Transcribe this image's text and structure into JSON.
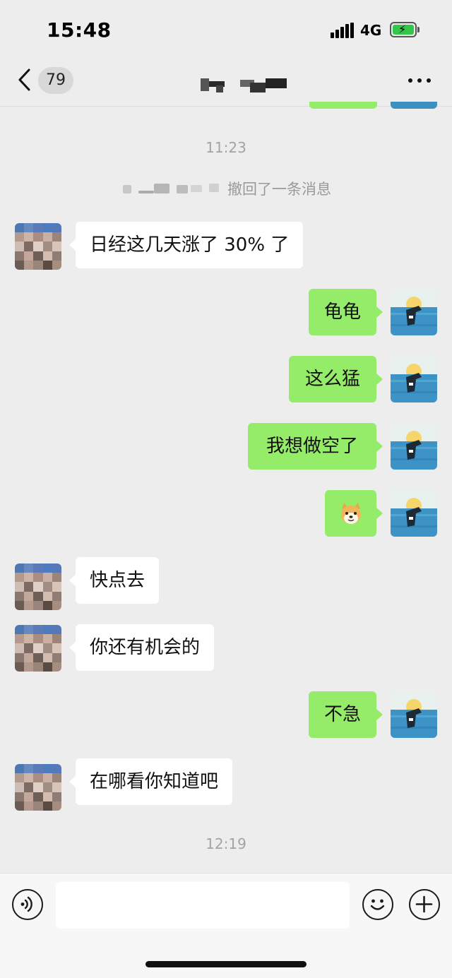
{
  "status": {
    "time": "15:48",
    "network": "4G"
  },
  "nav": {
    "unread_count": "79"
  },
  "timestamps": [
    "11:23",
    "12:19"
  ],
  "recall_notice": "撤回了一条消息",
  "messages": [
    {
      "side": "left",
      "text": "日经这几天涨了 30% 了"
    },
    {
      "side": "right",
      "text": "龟龟"
    },
    {
      "side": "right",
      "text": "这么猛"
    },
    {
      "side": "right",
      "text": "我想做空了"
    },
    {
      "side": "right",
      "text": "",
      "sticker": "doge-emoji"
    },
    {
      "side": "left",
      "text": "快点去"
    },
    {
      "side": "left",
      "text": "你还有机会的"
    },
    {
      "side": "right",
      "text": "不急"
    },
    {
      "side": "left",
      "text": "在哪看你知道吧"
    }
  ],
  "colors": {
    "sent_bubble": "#95ec69",
    "received_bubble": "#ffffff",
    "background": "#ededed"
  },
  "input": {
    "value": "",
    "placeholder": ""
  }
}
